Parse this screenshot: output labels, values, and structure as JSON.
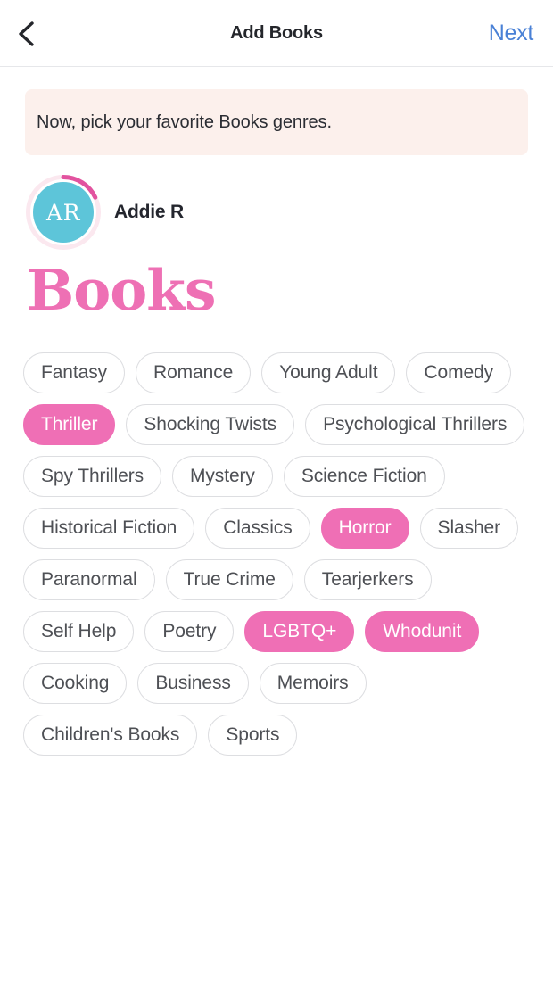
{
  "header": {
    "back_icon": "chevron-left-icon",
    "title": "Add Books",
    "next_label": "Next",
    "next_color": "#4a81d6",
    "title_color": "#24262b"
  },
  "banner": {
    "text": "Now, pick your favorite Books genres.",
    "background": "#fcf0ec"
  },
  "user": {
    "initials": "AR",
    "name": "Addie R",
    "avatar_color": "#5dc5d9",
    "ring_track_color": "#fbe8ef",
    "ring_progress_color": "#e2539f",
    "ring_progress_percent": 18
  },
  "section": {
    "title": "Books",
    "title_color": "#ee70b4"
  },
  "genres": {
    "selected_color": "#ef6fb5",
    "unselected_border": "#dddee1",
    "unselected_text": "#4e5055",
    "items": [
      {
        "label": "Fantasy",
        "selected": false
      },
      {
        "label": "Romance",
        "selected": false
      },
      {
        "label": "Young Adult",
        "selected": false
      },
      {
        "label": "Comedy",
        "selected": false
      },
      {
        "label": "Thriller",
        "selected": true
      },
      {
        "label": "Shocking Twists",
        "selected": false
      },
      {
        "label": "Psychological Thrillers",
        "selected": false
      },
      {
        "label": "Spy Thrillers",
        "selected": false
      },
      {
        "label": "Mystery",
        "selected": false
      },
      {
        "label": "Science Fiction",
        "selected": false
      },
      {
        "label": "Historical Fiction",
        "selected": false
      },
      {
        "label": "Classics",
        "selected": false
      },
      {
        "label": "Horror",
        "selected": true
      },
      {
        "label": "Slasher",
        "selected": false
      },
      {
        "label": "Paranormal",
        "selected": false
      },
      {
        "label": "True Crime",
        "selected": false
      },
      {
        "label": "Tearjerkers",
        "selected": false
      },
      {
        "label": "Self Help",
        "selected": false
      },
      {
        "label": "Poetry",
        "selected": false
      },
      {
        "label": "LGBTQ+",
        "selected": true
      },
      {
        "label": "Whodunit",
        "selected": true
      },
      {
        "label": "Cooking",
        "selected": false
      },
      {
        "label": "Business",
        "selected": false
      },
      {
        "label": "Memoirs",
        "selected": false
      },
      {
        "label": "Children's Books",
        "selected": false
      },
      {
        "label": "Sports",
        "selected": false
      }
    ]
  }
}
